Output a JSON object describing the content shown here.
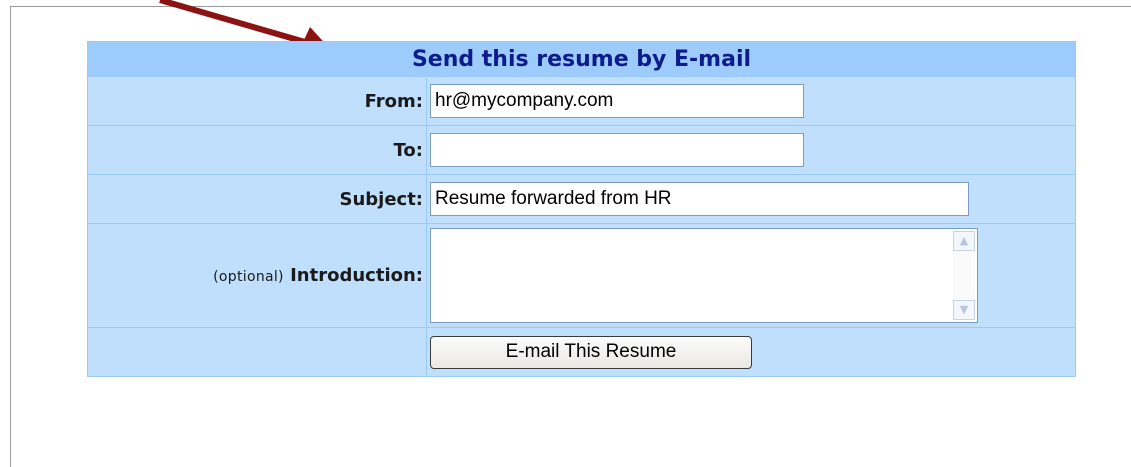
{
  "form": {
    "title": "Send this resume by E-mail",
    "from_label": "From:",
    "from_value": "hr@mycompany.com",
    "to_label": "To:",
    "to_value": "",
    "subject_label": "Subject:",
    "subject_value": "Resume forwarded from HR",
    "intro_optional": "(optional)",
    "intro_label": "Introduction:",
    "intro_value": "",
    "submit_label": "E-mail This Resume"
  },
  "colors": {
    "annotation_arrow": "#8b1313",
    "header_bg": "#9ccbfc",
    "row_bg": "#bfdffd",
    "title_text": "#0d1c8a"
  },
  "icons": {
    "scroll_up": "scroll-up-icon",
    "scroll_down": "scroll-down-icon",
    "annotation": "annotation-arrow-icon"
  }
}
